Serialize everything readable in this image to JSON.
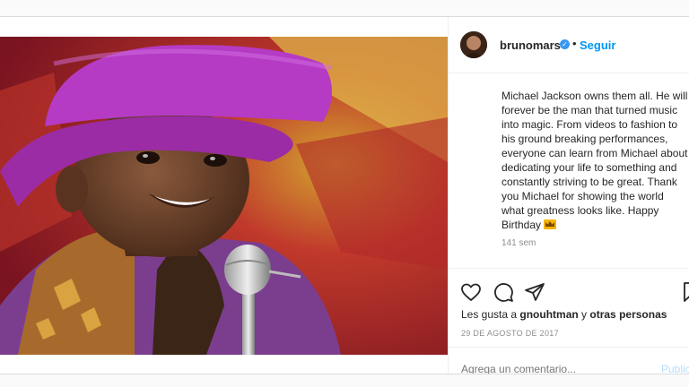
{
  "post": {
    "username": "brunomars",
    "separator": "•",
    "follow_label": "Seguir",
    "caption_lines": [
      "Michael Jackson owns them all. He will",
      "forever be the man that turned music",
      "into magic. From videos to fashion to",
      "his ground breaking performances,",
      "everyone can learn from Michael about",
      "dedicating your life to something and",
      "constantly striving to be great. Thank",
      "you Michael for showing the world",
      "what greatness looks like. Happy",
      "Birthday"
    ],
    "age": "141 sem",
    "likes_prefix": "Les gusta a ",
    "likes_user": "gnouhtman",
    "likes_conj": " y ",
    "likes_others": "otras personas",
    "date": "29 DE AGOSTO DE 2017",
    "comment_placeholder": "Agrega un comentario...",
    "publish_label": "Publicar"
  },
  "icons": {
    "verified": "verified-badge-icon",
    "like": "heart-icon",
    "comment": "comment-icon",
    "share": "share-icon",
    "save": "bookmark-icon",
    "crown": "crown-emoji"
  },
  "colors": {
    "link": "#0095f6",
    "verified": "#3897f0",
    "muted": "#8e8e8e",
    "text": "#262626"
  }
}
